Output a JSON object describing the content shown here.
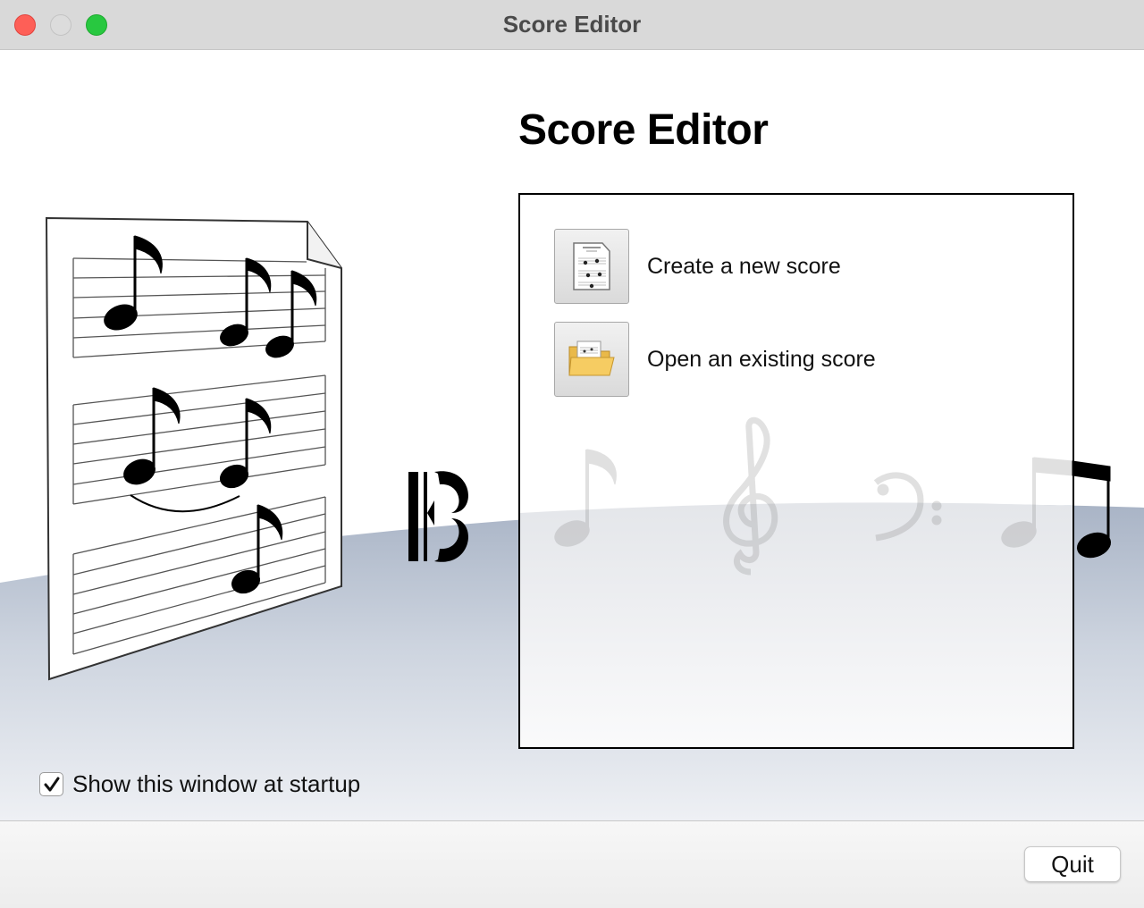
{
  "window": {
    "title": "Score Editor",
    "controls": [
      "close",
      "minimize",
      "zoom"
    ]
  },
  "heading": "Score Editor",
  "actions": [
    {
      "label": "Create a new score",
      "icon": "new-score-document-icon"
    },
    {
      "label": "Open an existing score",
      "icon": "open-folder-icon"
    }
  ],
  "startup": {
    "label": "Show this window at startup",
    "checked": true
  },
  "footer": {
    "quit_label": "Quit"
  },
  "decor": {
    "icons": [
      "sheet-music-page-icon",
      "alto-clef-icon",
      "eighth-note-icon",
      "treble-clef-icon",
      "bass-clef-icon",
      "beamed-notes-icon"
    ]
  },
  "colors": {
    "titlebar": "#d9d9d9",
    "close": "#fe5f57",
    "zoom": "#28c840",
    "floor": "#a9b4c6"
  }
}
